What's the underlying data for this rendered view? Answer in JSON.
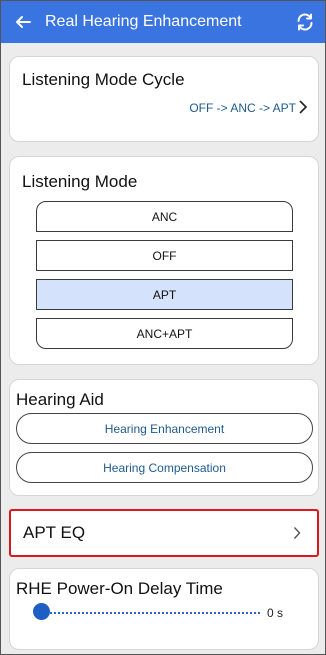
{
  "appbar": {
    "title": "Real Hearing Enhancement",
    "back_icon": "arrow-left-icon",
    "refresh_icon": "refresh-icon",
    "color": "#3a74e0"
  },
  "listening_mode_cycle": {
    "title": "Listening Mode Cycle",
    "value": "OFF -> ANC -> APT"
  },
  "listening_mode": {
    "title": "Listening Mode",
    "options": [
      "ANC",
      "OFF",
      "APT",
      "ANC+APT"
    ],
    "selected": "APT",
    "selected_color": "#d5e2fb"
  },
  "hearing_aid": {
    "title": "Hearing Aid",
    "buttons": [
      "Hearing Enhancement",
      "Hearing Compensation"
    ]
  },
  "apt_eq": {
    "label": "APT EQ"
  },
  "rhe_delay": {
    "title": "RHE Power-On Delay Time",
    "value": 0,
    "value_label": "0 s"
  }
}
